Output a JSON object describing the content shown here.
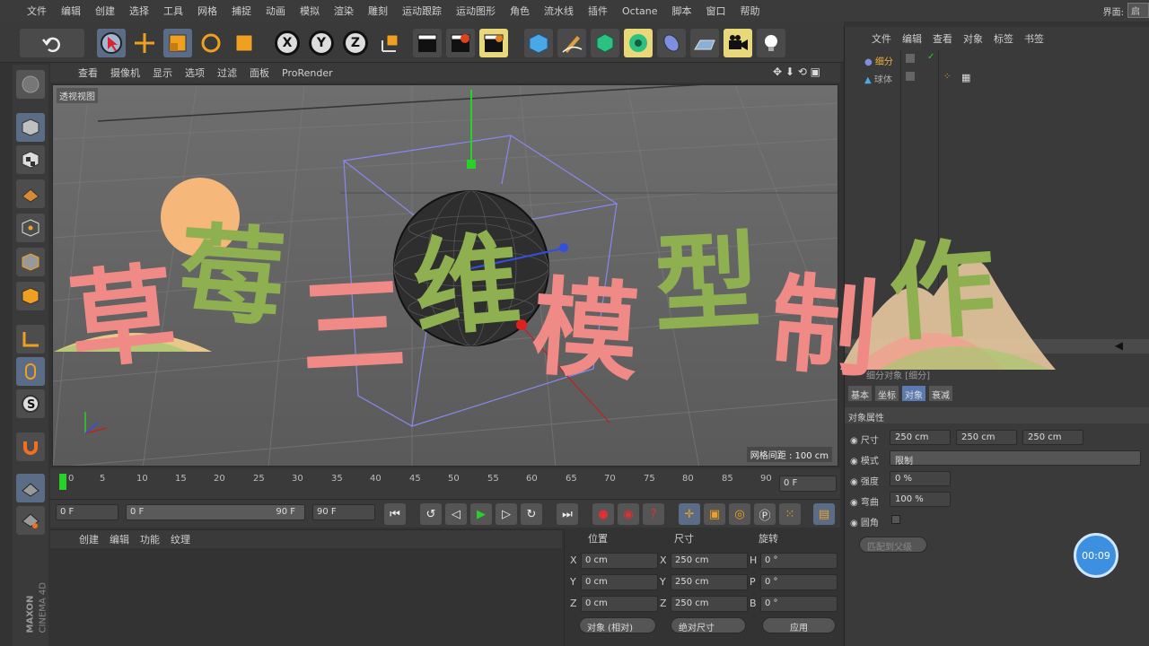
{
  "menubar": {
    "items": [
      "文件",
      "编辑",
      "创建",
      "选择",
      "工具",
      "网格",
      "捕捉",
      "动画",
      "模拟",
      "渲染",
      "雕刻",
      "运动跟踪",
      "运动图形",
      "角色",
      "流水线",
      "插件",
      "Octane",
      "脚本",
      "窗口",
      "帮助"
    ],
    "layout_label": "界面:",
    "layout_value": "启"
  },
  "toolbar": {
    "axis_x": "X",
    "axis_y": "Y",
    "axis_z": "Z"
  },
  "viewport": {
    "menu": [
      "查看",
      "摄像机",
      "显示",
      "选项",
      "过滤",
      "面板",
      "ProRender"
    ],
    "label": "透视视图",
    "grid_spacing": "网格间距 : 100 cm"
  },
  "timeline": {
    "ticks": [
      "0",
      "5",
      "10",
      "15",
      "20",
      "25",
      "30",
      "35",
      "40",
      "45",
      "50",
      "55",
      "60",
      "65",
      "70",
      "75",
      "80",
      "85",
      "90"
    ],
    "frame_field": "0 F"
  },
  "transport": {
    "start_frame": "0 F",
    "range_start": "0 F",
    "range_end": "90 F",
    "end_frame": "90 F"
  },
  "material": {
    "menu": [
      "创建",
      "编辑",
      "功能",
      "纹理"
    ]
  },
  "coords": {
    "header_pos": "位置",
    "header_size": "尺寸",
    "header_rot": "旋转",
    "rows": [
      {
        "axis": "X",
        "pos": "0 cm",
        "size_axis": "X",
        "size": "250 cm",
        "rot_axis": "H",
        "rot": "0 °"
      },
      {
        "axis": "Y",
        "pos": "0 cm",
        "size_axis": "Y",
        "size": "250 cm",
        "rot_axis": "P",
        "rot": "0 °"
      },
      {
        "axis": "Z",
        "pos": "0 cm",
        "size_axis": "Z",
        "size": "250 cm",
        "rot_axis": "B",
        "rot": "0 °"
      }
    ],
    "mode_dropdown": "对象 (相对)",
    "size_dropdown": "绝对尺寸",
    "apply_button": "应用"
  },
  "objects": {
    "menu": [
      "文件",
      "编辑",
      "查看",
      "对象",
      "标签",
      "书签"
    ],
    "items": [
      {
        "name": "细分"
      },
      {
        "name": "球体"
      }
    ]
  },
  "attributes": {
    "title": "细分对象 [细分]",
    "tabs": [
      "基本",
      "坐标",
      "对象",
      "衰减"
    ],
    "section": "对象属性",
    "size_label": "尺寸",
    "size_values": [
      "250 cm",
      "250 cm",
      "250 cm"
    ],
    "mode_label": "模式",
    "mode_value": "限制",
    "strength_label": "强度",
    "strength_value": "0 %",
    "bend_label": "弯曲",
    "bend_value": "100 %",
    "round_label": "圆角",
    "fit_button": "匹配到父级"
  },
  "overlay": {
    "chars": [
      "草",
      "莓",
      "三",
      "维",
      "模",
      "型",
      "制",
      "作"
    ]
  },
  "timer": "00:09",
  "brand": {
    "maxon": "MAXON",
    "product": "CINEMA 4D"
  },
  "colors": {
    "title_pink": "#f08a86",
    "title_green": "#8fb050",
    "timer_blue": "#3d8fe0"
  }
}
